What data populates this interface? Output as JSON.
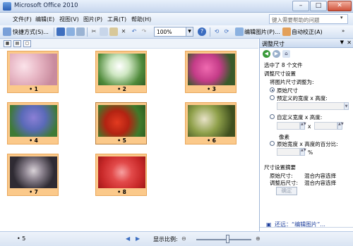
{
  "window": {
    "title": "Microsoft Office 2010"
  },
  "menu": {
    "items": [
      "文件(F)",
      "编辑(E)",
      "视图(V)",
      "图片(P)",
      "工具(T)",
      "帮助(H)"
    ]
  },
  "help_box": {
    "placeholder": "键入需要帮助的问题"
  },
  "toolbar": {
    "shortcuts_label": "快捷方式(S)...",
    "zoom": "100%",
    "edit_picture_label": "编辑图片(P)...",
    "auto_correct_label": "自动校正(A)"
  },
  "gallery": {
    "tiles": [
      {
        "caption": "• 1"
      },
      {
        "caption": "• 2"
      },
      {
        "caption": "• 3"
      },
      {
        "caption": "• 4"
      },
      {
        "caption": "• 5"
      },
      {
        "caption": "• 6"
      },
      {
        "caption": "• 7"
      },
      {
        "caption": "• 8"
      }
    ]
  },
  "pane": {
    "title": "调整尺寸",
    "selected_count": "选中了 8 个文件",
    "section_settings": "调整尺寸设置",
    "resize_pictures_to": "将图片尺寸调整为:",
    "option_original": "原始尺寸",
    "option_predefined": "预定义的宽度 x 高度:",
    "option_custom": "自定义宽度 x 高度:",
    "x_sep": "x",
    "pixels": "像素",
    "option_percent": "原始宽度 x 高度的百分比:",
    "percent_sign": "%",
    "section_summary": "尺寸设置摘要",
    "original_size_label": "原始尺寸:",
    "original_size_value": "混合内容选择",
    "adjusted_size_label": "调整后尺寸:",
    "adjusted_size_value": "混合内容选择",
    "ok_button": "确定",
    "link": "还远：“编辑图片”..."
  },
  "status": {
    "count": "• 5",
    "zoom_label": "显示比例:"
  }
}
